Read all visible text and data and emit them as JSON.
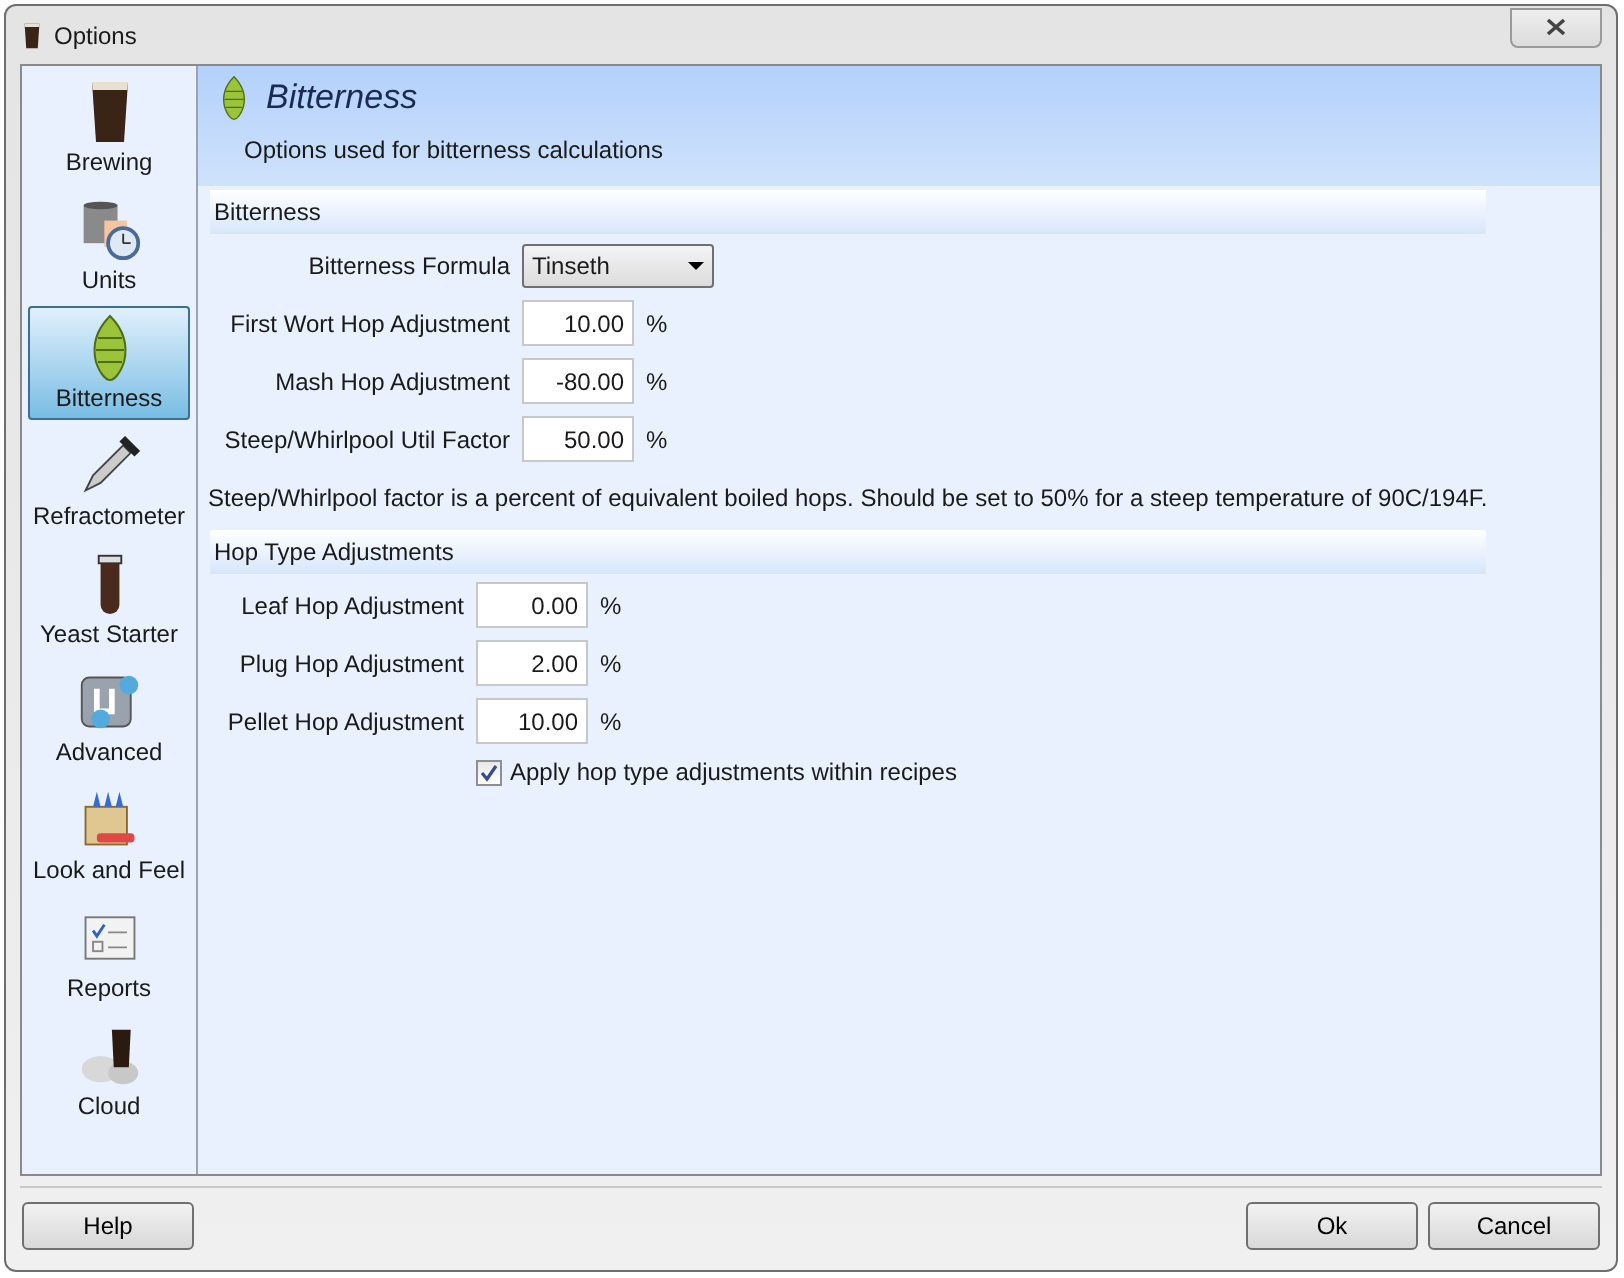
{
  "window": {
    "title": "Options"
  },
  "sidebar": {
    "items": [
      {
        "label": "Brewing",
        "selected": false
      },
      {
        "label": "Units",
        "selected": false
      },
      {
        "label": "Bitterness",
        "selected": true
      },
      {
        "label": "Refractometer",
        "selected": false
      },
      {
        "label": "Yeast Starter",
        "selected": false
      },
      {
        "label": "Advanced",
        "selected": false
      },
      {
        "label": "Look and Feel",
        "selected": false
      },
      {
        "label": "Reports",
        "selected": false
      },
      {
        "label": "Cloud",
        "selected": false
      }
    ]
  },
  "header": {
    "title": "Bitterness",
    "subtitle": "Options used for bitterness calculations"
  },
  "sections": [
    {
      "title": "Bitterness",
      "rows": [
        {
          "kind": "dropdown",
          "label": "Bitterness Formula",
          "value": "Tinseth"
        },
        {
          "kind": "number",
          "label": "First Wort Hop Adjustment",
          "value": "10.00",
          "unit": "%"
        },
        {
          "kind": "number",
          "label": "Mash Hop Adjustment",
          "value": "-80.00",
          "unit": "%"
        },
        {
          "kind": "number",
          "label": "Steep/Whirlpool Util Factor",
          "value": "50.00",
          "unit": "%"
        },
        {
          "kind": "note",
          "text": "Steep/Whirlpool factor is a percent of equivalent boiled hops.  Should be set to 50% for a steep temperature of 90C/194F."
        }
      ]
    },
    {
      "title": "Hop Type Adjustments",
      "rows": [
        {
          "kind": "number",
          "label": "Leaf Hop Adjustment",
          "value": "0.00",
          "unit": "%"
        },
        {
          "kind": "number",
          "label": "Plug Hop Adjustment",
          "value": "2.00",
          "unit": "%"
        },
        {
          "kind": "number",
          "label": "Pellet Hop Adjustment",
          "value": "10.00",
          "unit": "%"
        },
        {
          "kind": "checkbox",
          "label": "Apply hop type adjustments within recipes",
          "checked": true
        }
      ]
    }
  ],
  "buttons": {
    "help": "Help",
    "ok": "Ok",
    "cancel": "Cancel"
  }
}
